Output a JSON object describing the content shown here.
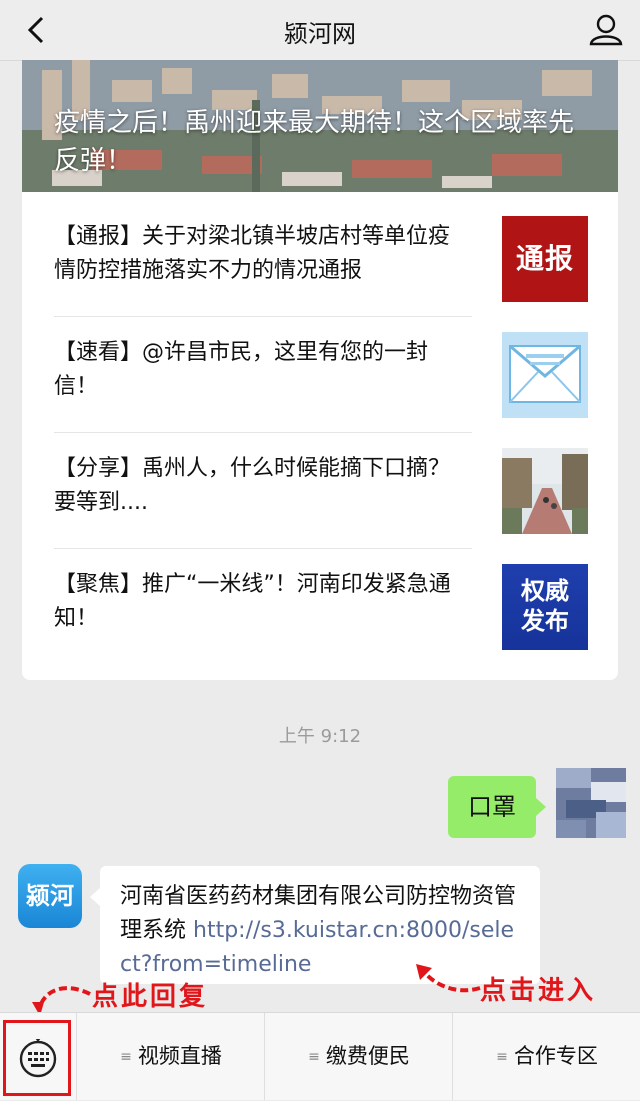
{
  "header": {
    "title": "颍河网"
  },
  "article": {
    "hero_title": "疫情之后！禹州迎来最大期待！这个区域率先反弹！",
    "items": [
      {
        "text": "【通报】关于对梁北镇半坡店村等单位疫情防控措施落实不力的情况通报",
        "thumb_text": "通报"
      },
      {
        "text": "【速看】@许昌市民，这里有您的一封信！"
      },
      {
        "text": "【分享】禹州人，什么时候能摘下口摘？要等到...."
      },
      {
        "text": "【聚焦】推广“一米线”！河南印发紧急通知！",
        "thumb_text_1": "权威",
        "thumb_text_2": "发布"
      }
    ]
  },
  "chat": {
    "timestamp": "上午 9:12",
    "sent_message": "口罩",
    "received": {
      "avatar_text": "颍河",
      "text": "河南省医药药材集团有限公司防控物资管理系统 ",
      "link": "http://s3.kuistar.cn:8000/select?from=timeline"
    }
  },
  "annotations": {
    "reply_hint": "点此回复",
    "enter_hint": "点击进入"
  },
  "menu": {
    "items": [
      "视频直播",
      "缴费便民",
      "合作专区"
    ]
  },
  "colors": {
    "sent_bubble": "#95ec69",
    "link": "#576b95",
    "annotation": "#e0161a"
  }
}
